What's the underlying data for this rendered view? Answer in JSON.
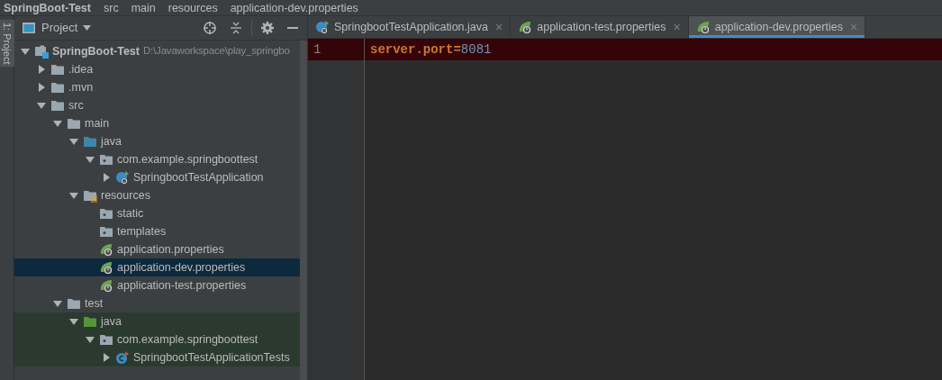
{
  "breadcrumb": [
    "SpringBoot-Test",
    "src",
    "main",
    "resources",
    "application-dev.properties"
  ],
  "tool_strip": {
    "label": "1: Project"
  },
  "project_panel": {
    "title": "Project",
    "tree": [
      {
        "kind": "module",
        "label": "SpringBoot-Test",
        "path": "D:\\Javaworkspace\\play_springbo",
        "expanded": true,
        "selected": false,
        "test_scope": false,
        "children": [
          {
            "kind": "folder",
            "label": ".idea",
            "expanded": false,
            "selected": false,
            "test_scope": false
          },
          {
            "kind": "folder",
            "label": ".mvn",
            "expanded": false,
            "selected": false,
            "test_scope": false
          },
          {
            "kind": "folder",
            "label": "src",
            "expanded": true,
            "selected": false,
            "test_scope": false,
            "children": [
              {
                "kind": "folder",
                "label": "main",
                "expanded": true,
                "selected": false,
                "test_scope": false,
                "children": [
                  {
                    "kind": "source-root",
                    "label": "java",
                    "expanded": true,
                    "selected": false,
                    "test_scope": false,
                    "children": [
                      {
                        "kind": "package",
                        "label": "com.example.springboottest",
                        "expanded": true,
                        "selected": false,
                        "test_scope": false,
                        "children": [
                          {
                            "kind": "app-class",
                            "label": "SpringbootTestApplication",
                            "expanded": false,
                            "selected": false,
                            "test_scope": false
                          }
                        ]
                      }
                    ]
                  },
                  {
                    "kind": "resource-root",
                    "label": "resources",
                    "expanded": true,
                    "selected": false,
                    "test_scope": false,
                    "children": [
                      {
                        "kind": "package",
                        "label": "static",
                        "selected": false,
                        "test_scope": false
                      },
                      {
                        "kind": "package",
                        "label": "templates",
                        "selected": false,
                        "test_scope": false
                      },
                      {
                        "kind": "properties",
                        "label": "application.properties",
                        "selected": false,
                        "test_scope": false
                      },
                      {
                        "kind": "properties",
                        "label": "application-dev.properties",
                        "selected": true,
                        "test_scope": false
                      },
                      {
                        "kind": "properties",
                        "label": "application-test.properties",
                        "selected": false,
                        "test_scope": false
                      }
                    ]
                  }
                ]
              },
              {
                "kind": "folder",
                "label": "test",
                "expanded": true,
                "selected": false,
                "test_scope": false,
                "children": [
                  {
                    "kind": "test-root",
                    "label": "java",
                    "expanded": true,
                    "selected": false,
                    "test_scope": true,
                    "children": [
                      {
                        "kind": "package",
                        "label": "com.example.springboottest",
                        "expanded": true,
                        "selected": false,
                        "test_scope": true,
                        "children": [
                          {
                            "kind": "test-class",
                            "label": "SpringbootTestApplicationTests",
                            "expanded": false,
                            "selected": false,
                            "test_scope": true
                          }
                        ]
                      }
                    ]
                  }
                ]
              }
            ]
          }
        ]
      }
    ]
  },
  "editor": {
    "tabs": [
      {
        "kind": "app-class",
        "label": "SpringbootTestApplication.java",
        "selected": false
      },
      {
        "kind": "properties",
        "label": "application-test.properties",
        "selected": false
      },
      {
        "kind": "properties",
        "label": "application-dev.properties",
        "selected": true
      }
    ],
    "close_glyph": "×",
    "lines": [
      {
        "number": "1",
        "key": "server.port",
        "separator": "=",
        "value": "8081",
        "highlighted": true
      }
    ]
  }
}
